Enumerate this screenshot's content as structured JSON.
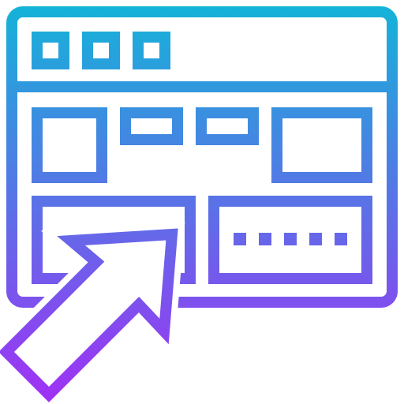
{
  "icon": {
    "name": "browser-window-cursor-icon",
    "colors": {
      "gradient_top": "#12b5d8",
      "gradient_bottom": "#a130f5",
      "background": "#ffffff"
    }
  }
}
